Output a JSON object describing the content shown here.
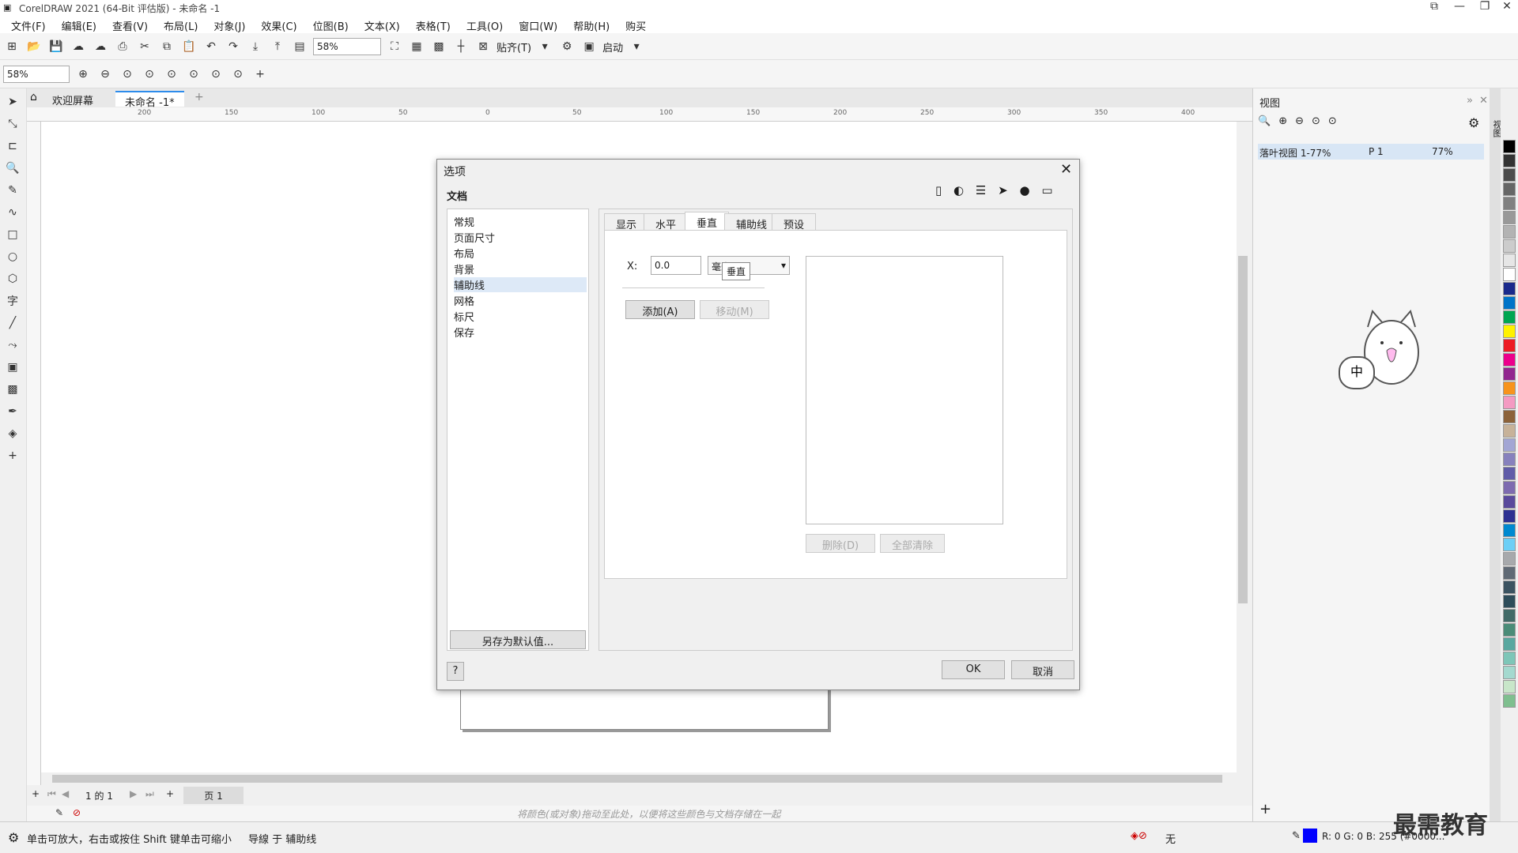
{
  "window": {
    "title": "CorelDRAW 2021 (64-Bit 评估版) - 未命名 -1"
  },
  "menu": [
    "文件(F)",
    "编辑(E)",
    "查看(V)",
    "布局(L)",
    "对象(J)",
    "效果(C)",
    "位图(B)",
    "文本(X)",
    "表格(T)",
    "工具(O)",
    "窗口(W)",
    "帮助(H)",
    "购买"
  ],
  "toolbar": {
    "zoom_value": "58%",
    "snap_label": "贴齐(T)",
    "launch_label": "启动"
  },
  "toolbar2": {
    "zoom_value": "58%"
  },
  "doc_tabs": {
    "welcome": "欢迎屏幕",
    "doc": "未命名 -1*"
  },
  "ruler_ticks": [
    "200",
    "150",
    "100",
    "50",
    "0",
    "50",
    "100",
    "150",
    "200",
    "250",
    "300",
    "350",
    "400"
  ],
  "pagebar": {
    "counter": "1 的 1",
    "page_tab": "页 1"
  },
  "palette_hint": "将颜色(或对象)拖动至此处，以便将这些颜色与文档存储在一起",
  "status": {
    "hint": "单击可放大，右击或按住 Shift 键单击可缩小",
    "snap": "导線 于 辅助线",
    "fill": "无",
    "color": "R: 0 G: 0 B: 255 (#0000..."
  },
  "docker": {
    "title": "视图",
    "row_name": "落叶视图 1-77%",
    "row_page": "P 1",
    "row_zoom": "77%"
  },
  "dialog": {
    "title": "选项",
    "section": "文档",
    "tree": [
      "常规",
      "页面尺寸",
      "布局",
      "背景",
      "辅助线",
      "网格",
      "标尺",
      "保存"
    ],
    "selected_tree": "辅助线",
    "save_default": "另存为默认值...",
    "tabs": [
      "显示",
      "水平",
      "垂直",
      "辅助线",
      "预设"
    ],
    "active_tab": "垂直",
    "tooltip": "垂直",
    "x_label": "X:",
    "x_value": "0.0",
    "unit": "毫米",
    "add": "添加(A)",
    "move": "移动(M)",
    "delete": "删除(D)",
    "clear_all": "全部清除",
    "help": "?",
    "ok": "OK",
    "cancel": "取消"
  },
  "cat_text": "中",
  "watermark": "最需教育",
  "palette_colors": [
    "#000000",
    "#333333",
    "#4d4d4d",
    "#666666",
    "#808080",
    "#999999",
    "#b3b3b3",
    "#cccccc",
    "#e6e6e6",
    "#ffffff",
    "#1a2a8c",
    "#0074c8",
    "#00a651",
    "#fff200",
    "#ed1c24",
    "#ec008c",
    "#92278f",
    "#f7941d",
    "#f49ac2",
    "#8c6239",
    "#c7b299",
    "#a3a6d4",
    "#8781bd",
    "#605ca8",
    "#7e6bb0",
    "#5a4a9c",
    "#2e3192",
    "#0089d0",
    "#6dcff6",
    "#a7a9ac",
    "#606a75",
    "#3b5361",
    "#2e4d5a",
    "#426b68",
    "#4b8c78",
    "#59a8a0",
    "#7ec6b8",
    "#a4d9cf",
    "#c8e6c9",
    "#7fbf8f"
  ]
}
